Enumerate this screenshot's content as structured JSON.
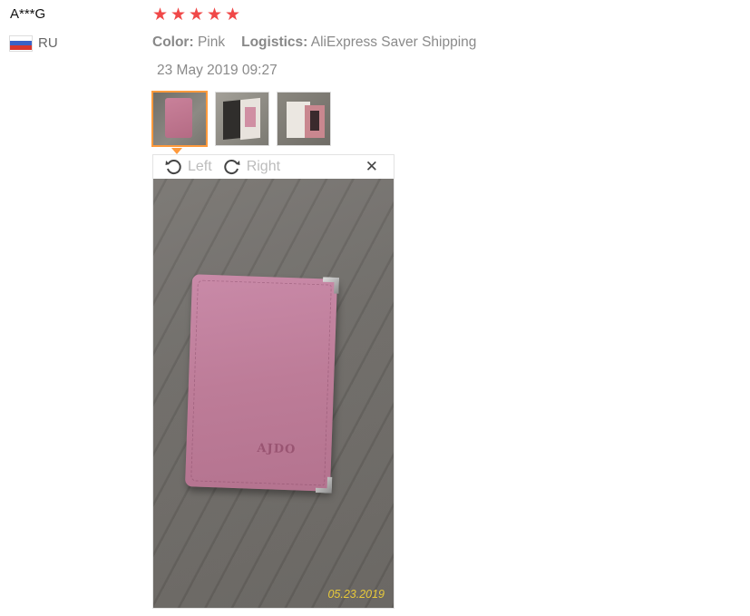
{
  "reviewer": {
    "name": "A***G",
    "country": "RU",
    "rating": 5,
    "star_glyph": "★"
  },
  "order_info": {
    "color_label": "Color:",
    "color_value": "Pink",
    "logistics_label": "Logistics:",
    "logistics_value": "AliExpress Saver Shipping"
  },
  "review_date": "23 May 2019 09:27",
  "thumbnails": [
    {
      "name": "photo-1",
      "selected": true
    },
    {
      "name": "photo-2",
      "selected": false
    },
    {
      "name": "photo-3",
      "selected": false
    }
  ],
  "viewer": {
    "rotate_left_label": "Left",
    "rotate_right_label": "Right",
    "close_glyph": "✕",
    "photo_date_stamp": "05.23.2019",
    "product_logo_text": "AJDO"
  },
  "colors": {
    "star": "#f04848",
    "selected_border": "#ff9a3c",
    "stamp": "#e8c93a"
  }
}
